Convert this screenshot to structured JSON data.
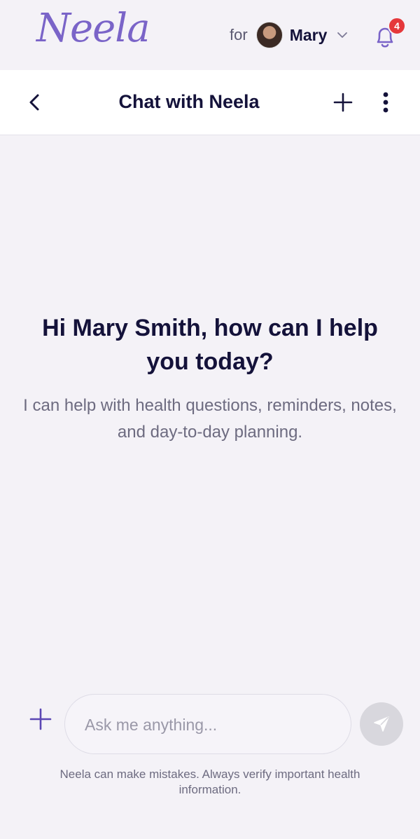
{
  "brand": {
    "logo_text": "Neela"
  },
  "profile": {
    "for_label": "for",
    "name": "Mary"
  },
  "notifications": {
    "count": "4"
  },
  "header": {
    "title": "Chat with Neela"
  },
  "welcome": {
    "title": "Hi Mary Smith, how can I help you today?",
    "subtitle": "I can help with health questions, reminders, notes, and day-to-day planning."
  },
  "composer": {
    "placeholder": "Ask me anything..."
  },
  "footer": {
    "disclaimer": "Neela can make mistakes. Always verify important health information."
  },
  "colors": {
    "accent": "#7a64c8",
    "badge": "#e5383b",
    "text": "#14123a",
    "muted": "#6d6b80"
  },
  "icons": [
    "chevron-down-icon",
    "bell-icon",
    "back-arrow-icon",
    "plus-icon",
    "more-vertical-icon",
    "send-icon"
  ]
}
